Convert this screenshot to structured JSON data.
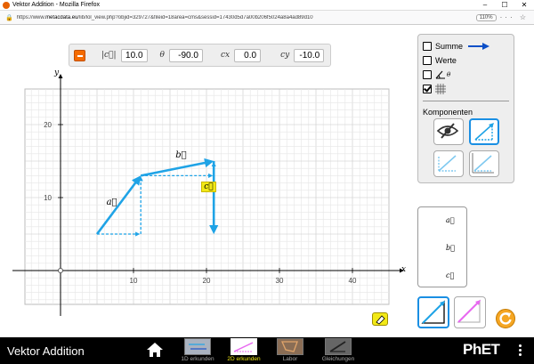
{
  "window": {
    "title": "Vektor Addition - Mozilla Firefox",
    "url_prefix": "https://www.",
    "url_domain": "metacdata.eu",
    "url_rest": "/lib/lol_view.php?objid=329727&fileid=18area=cms&sessid=17430d5d7a00b206f5024a8a4ad89d10",
    "zoom": "110%"
  },
  "readout": {
    "magnitude_label": "|c⃗|",
    "magnitude_value": "10.0",
    "angle_label": "θ",
    "angle_value": "-90.0",
    "cx_label": "cx",
    "cx_value": "0.0",
    "cy_label": "cy",
    "cy_value": "-10.0"
  },
  "graph": {
    "x_axis_label": "x",
    "y_axis_label": "y",
    "x_ticks": [
      "10",
      "20",
      "30",
      "40"
    ],
    "y_ticks": [
      "10",
      "20"
    ],
    "vectors": [
      {
        "name": "a",
        "label": "a⃗",
        "tail": [
          5,
          5
        ],
        "tip": [
          11,
          13
        ]
      },
      {
        "name": "b",
        "label": "b⃗",
        "tail": [
          11,
          13
        ],
        "tip": [
          21,
          15
        ]
      },
      {
        "name": "c",
        "label": "c⃗",
        "tail": [
          21,
          15
        ],
        "tip": [
          21,
          5
        ]
      }
    ]
  },
  "options_panel": {
    "sum_label": "Summe",
    "values_label": "Werte",
    "angle_label": "θ",
    "grid_checked": true,
    "sum_checked": false,
    "values_checked": false,
    "angle_checked": false,
    "components_label": "Komponenten"
  },
  "vector_list": [
    "a⃗",
    "b⃗",
    "c⃗"
  ],
  "navbar": {
    "sim_title": "Vektor Addition",
    "screens": [
      "1D erkunden",
      "2D erkunden",
      "Labor",
      "Gleichungen"
    ],
    "active_screen": 1,
    "logo_text": "PhET"
  },
  "colors": {
    "vector": "#1fa3e6",
    "accent_yellow": "#f2e916",
    "orange": "#f56b00",
    "sum": "#0b4fc7",
    "pink": "#e868f0"
  }
}
